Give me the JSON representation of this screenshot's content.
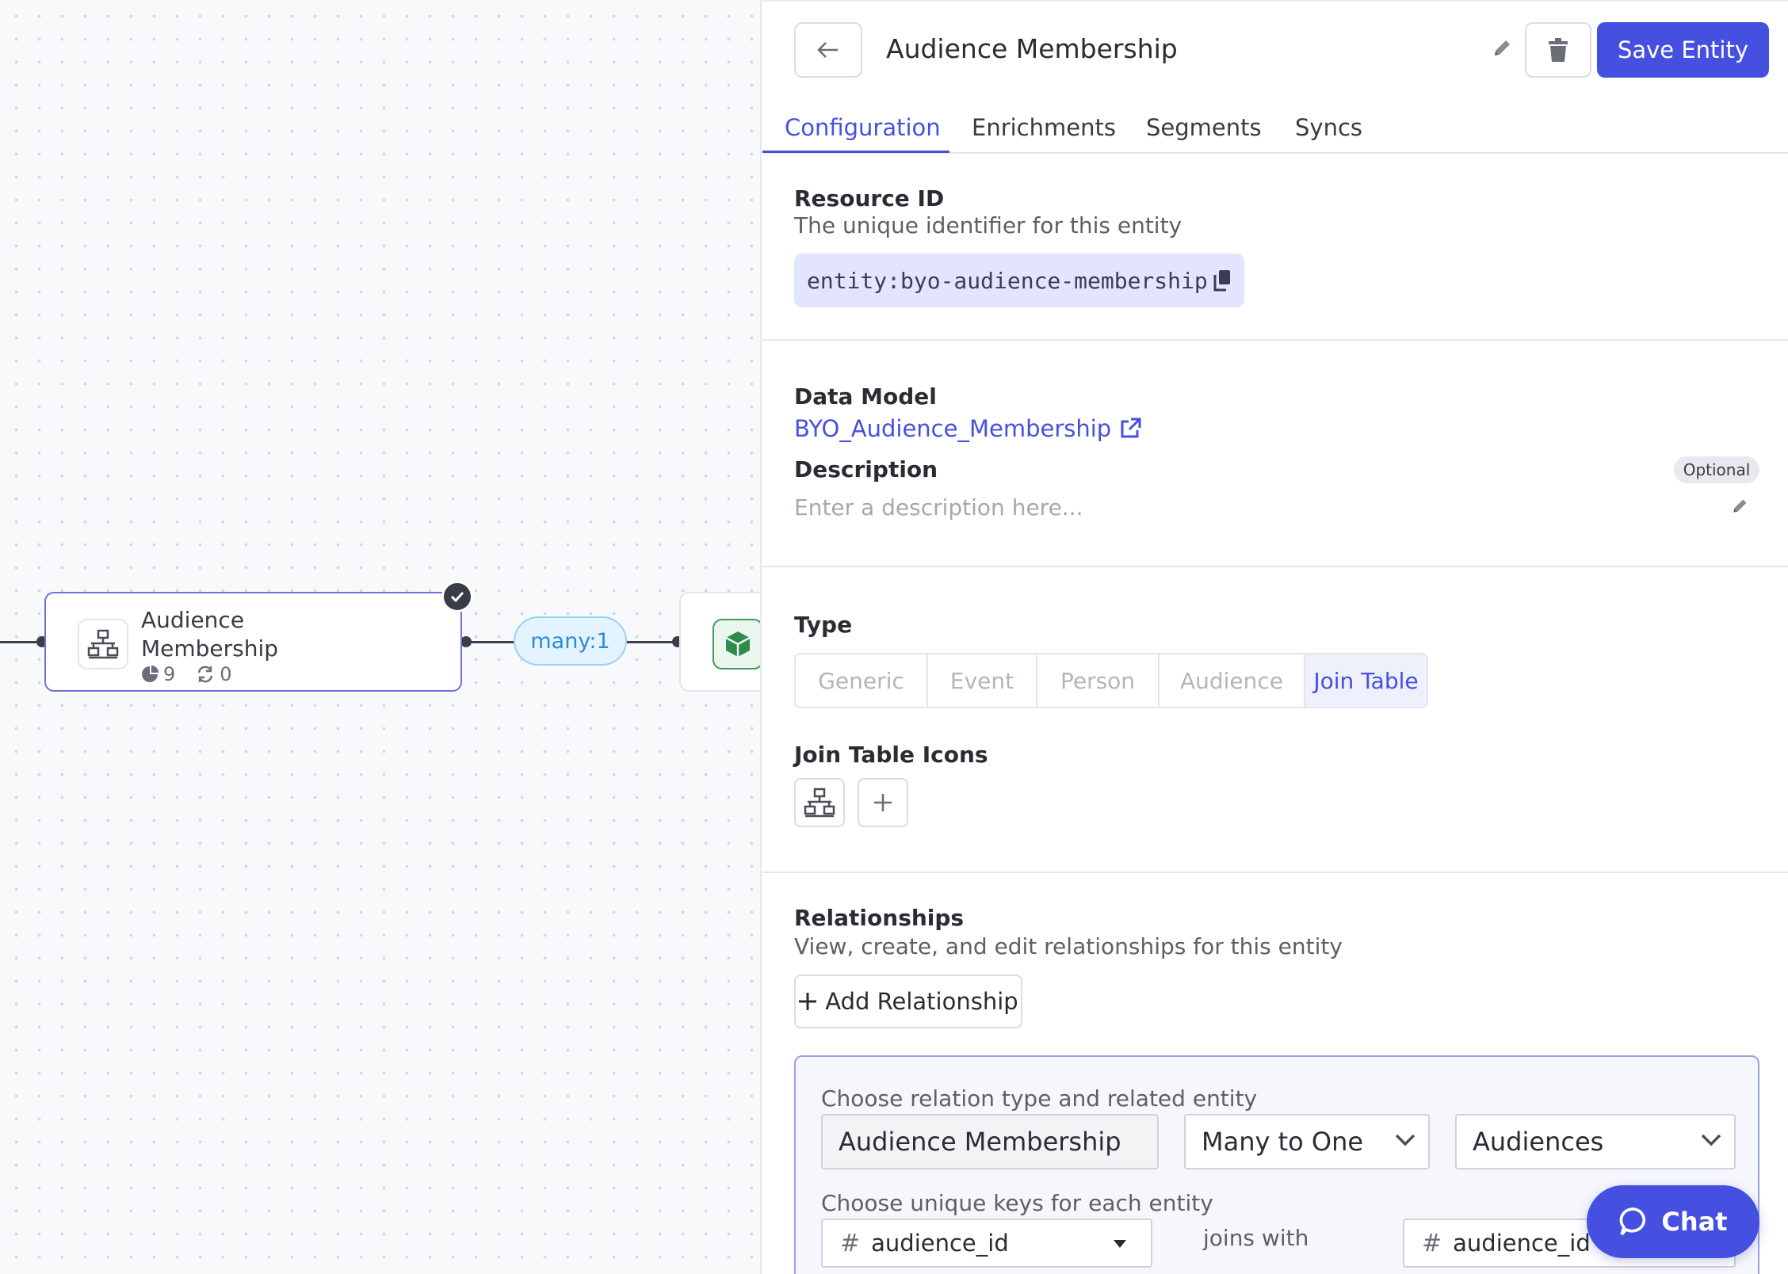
{
  "canvas": {
    "node": {
      "title": "Audience Membership",
      "segments_count": "9",
      "syncs_count": "0"
    },
    "relationship_pill": "many:1"
  },
  "panel": {
    "title": "Audience Membership",
    "save_label": "Save Entity",
    "tabs": [
      {
        "label": "Configuration",
        "active": true
      },
      {
        "label": "Enrichments",
        "active": false
      },
      {
        "label": "Segments",
        "active": false
      },
      {
        "label": "Syncs",
        "active": false
      }
    ],
    "resource": {
      "label": "Resource ID",
      "help": "The unique identifier for this entity",
      "value": "entity:byo-audience-membership"
    },
    "data_model": {
      "label": "Data Model",
      "link": "BYO_Audience_Membership"
    },
    "description": {
      "label": "Description",
      "badge": "Optional",
      "placeholder": "Enter a description here..."
    },
    "type": {
      "label": "Type",
      "options": [
        "Generic",
        "Event",
        "Person",
        "Audience",
        "Join Table"
      ],
      "selected": "Join Table"
    },
    "icons": {
      "label": "Join Table Icons"
    },
    "relationships": {
      "label": "Relationships",
      "help": "View, create, and edit relationships for this entity",
      "add_label": "Add Relationship",
      "card": {
        "relation_label": "Choose relation type and related entity",
        "source_entity": "Audience Membership",
        "relation_type": "Many to One",
        "target_entity": "Audiences",
        "keys_label": "Choose unique keys for each entity",
        "source_key": "audience_id",
        "joins_with": "joins with",
        "target_key": "audience_id"
      }
    }
  },
  "chat": {
    "label": "Chat"
  },
  "colors": {
    "accent": "#4550e0",
    "edge_pill": "#2f8bd6",
    "node_border": "#6b72d8"
  }
}
